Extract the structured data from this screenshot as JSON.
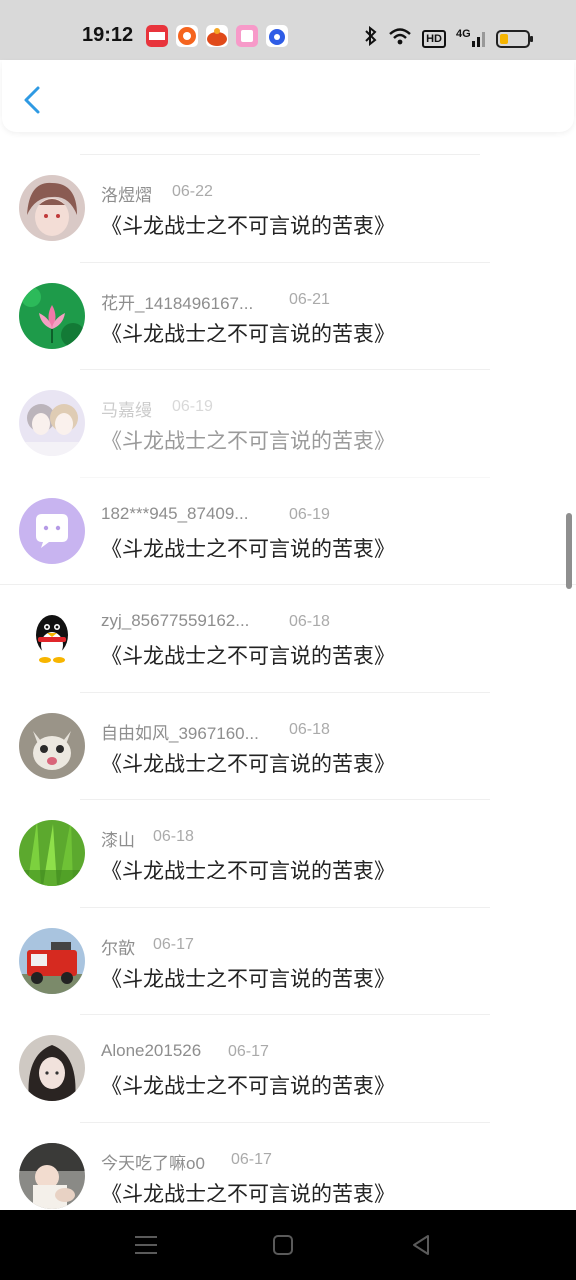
{
  "status_bar": {
    "time": "19:12",
    "hd_label": "HD",
    "network_label": "4G",
    "battery_level": 0.3,
    "battery_color": "#f5b400",
    "notification_icons": [
      "toutiao-icon",
      "taobao-icon",
      "game-icon",
      "album-icon",
      "baidu-icon"
    ],
    "system_icons": [
      "bluetooth-icon",
      "wifi-icon",
      "hd-icon",
      "signal-icon",
      "battery-icon"
    ]
  },
  "header": {
    "back_icon": "chevron-left-icon",
    "accent": "#2f9ae3"
  },
  "list": {
    "items": [
      {
        "user": "洛煜熠",
        "date": "06-22",
        "title": "《斗龙战士之不可言说的苦衷》",
        "avatar": "anime-boy"
      },
      {
        "user": "花开_1418496167...",
        "date": "06-21",
        "title": "《斗龙战士之不可言说的苦衷》",
        "avatar": "lotus"
      },
      {
        "user": "马嘉缦",
        "date": "06-19",
        "title": "《斗龙战士之不可言说的苦衷》",
        "avatar": "two-girls"
      },
      {
        "user": "182***945_87409...",
        "date": "06-19",
        "title": "《斗龙战士之不可言说的苦衷》",
        "avatar": "chat-bubble"
      },
      {
        "user": "zyj_85677559162...",
        "date": "06-18",
        "title": "《斗龙战士之不可言说的苦衷》",
        "avatar": "penguin"
      },
      {
        "user": "自由如风_3967160...",
        "date": "06-18",
        "title": "《斗龙战士之不可言说的苦衷》",
        "avatar": "cat"
      },
      {
        "user": "漆山",
        "date": "06-18",
        "title": "《斗龙战士之不可言说的苦衷》",
        "avatar": "grass"
      },
      {
        "user": "尔歆",
        "date": "06-17",
        "title": "《斗龙战士之不可言说的苦衷》",
        "avatar": "fire-truck"
      },
      {
        "user": "Alone201526",
        "date": "06-17",
        "title": "《斗龙战士之不可言说的苦衷》",
        "avatar": "girl-portrait"
      },
      {
        "user": "今天吃了嘛o0",
        "date": "06-17",
        "title": "《斗龙战士之不可言说的苦衷》",
        "avatar": "baby"
      }
    ]
  },
  "nav_bar": {
    "icons": [
      "menu-icon",
      "home-icon",
      "back-triangle-icon"
    ]
  }
}
